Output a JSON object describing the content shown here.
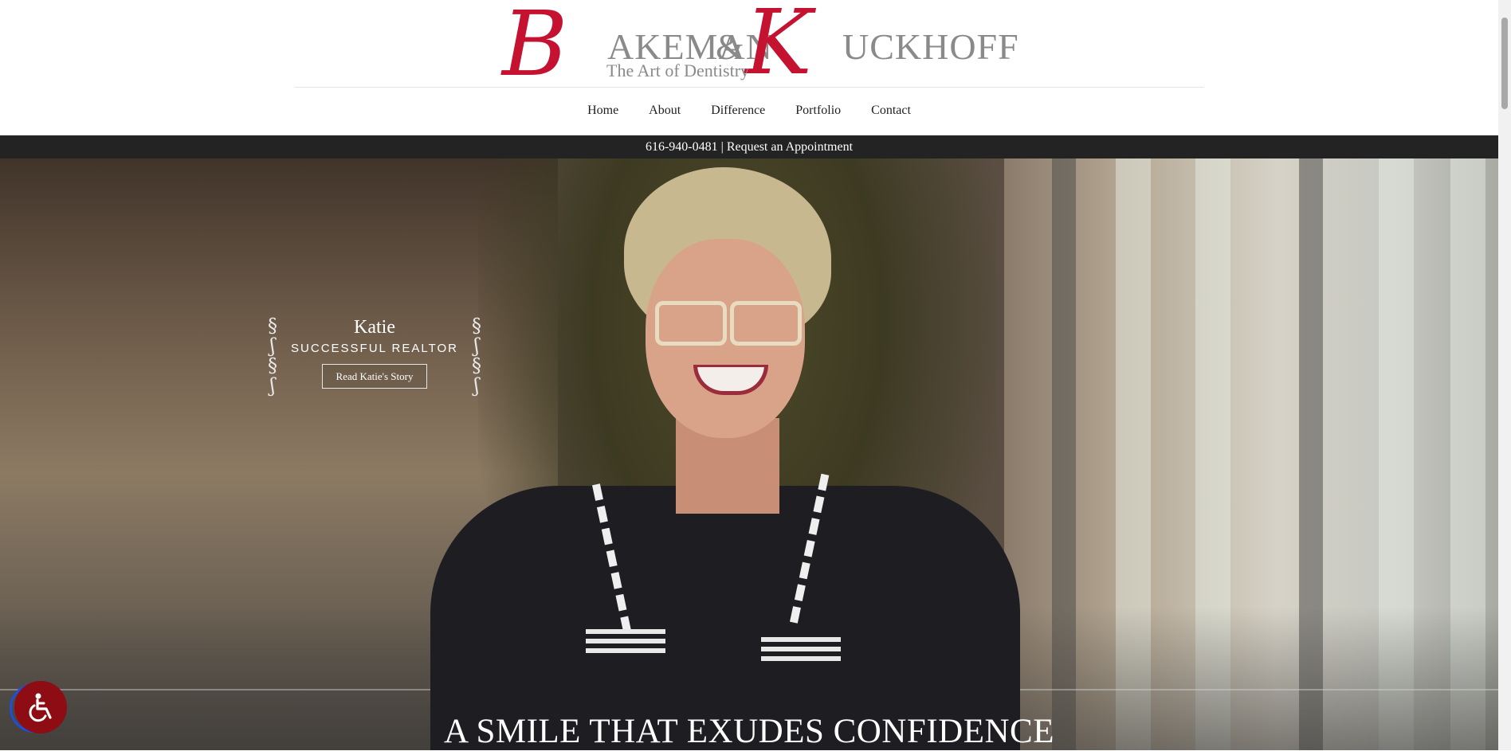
{
  "brand": {
    "initial_b": "B",
    "word_1": "AKEMAN",
    "ampersand": "&",
    "initial_k": "K",
    "word_2": "UCKHOFF",
    "tagline": "The Art of Dentistry"
  },
  "nav": {
    "items": [
      {
        "label": "Home"
      },
      {
        "label": "About"
      },
      {
        "label": "Difference"
      },
      {
        "label": "Portfolio"
      },
      {
        "label": "Contact"
      }
    ]
  },
  "topbar": {
    "phone": "616-940-0481",
    "separator": "|",
    "cta": "Request an Appointment"
  },
  "hero": {
    "story": {
      "name": "Katie",
      "role": "SUCCESSFUL REALTOR",
      "button": "Read Katie's Story"
    },
    "headline": "A SMILE THAT EXUDES CONFIDENCE"
  },
  "colors": {
    "brand_red": "#c41230",
    "brand_gray": "#8a8a8a",
    "topbar": "#232323",
    "a11y_button": "#8e0c14"
  },
  "icons": {
    "accessibility": "wheelchair-icon",
    "flourish": "scroll-ornament-icon"
  }
}
